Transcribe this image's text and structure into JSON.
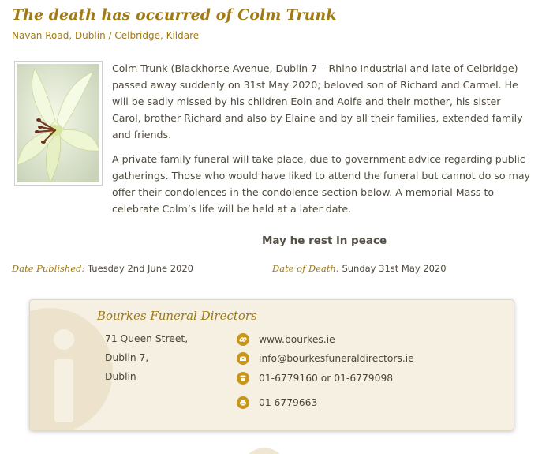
{
  "notice": {
    "title": "The death has occurred of Colm Trunk",
    "location": "Navan Road, Dublin / Celbridge, Kildare",
    "paragraphs": [
      "Colm Trunk (Blackhorse Avenue, Dublin 7 – Rhino Industrial and late of Celbridge) passed away suddenly on 31st May 2020; beloved son of Richard and Carmel. He will be sadly missed by his children Eoin and Aoife and their mother, his sister Carol, brother Richard and also by Elaine and by all their families, extended family and friends.",
      "A private family funeral will take place, due to government advice regarding public gatherings. Those who would have liked to attend the funeral but cannot do so may offer their condolences in the condolence section below. A memorial Mass to celebrate Colm’s life will be held at a later date."
    ],
    "rip": "May he rest in peace",
    "date_published_label": "Date Published:",
    "date_published": "Tuesday 2nd June 2020",
    "date_of_death_label": "Date of Death:",
    "date_of_death": "Sunday 31st May 2020",
    "photo_icon": "lily-flower-image"
  },
  "director": {
    "name": "Bourkes Funeral Directors",
    "address": [
      "71 Queen Street,",
      "Dublin 7,",
      "Dublin"
    ],
    "website": "www.bourkes.ie",
    "email": "info@bourkesfuneraldirectors.ie",
    "phone": "01-6779160 or 01-6779098",
    "fax": "01 6779663",
    "icons": [
      "link-icon",
      "email-icon",
      "phone-icon",
      "fax-icon"
    ]
  },
  "colors": {
    "accent": "#a07a14",
    "icon_bg": "#c8971a",
    "card_bg": "#f6f0e2",
    "text": "#4f4a3c"
  }
}
